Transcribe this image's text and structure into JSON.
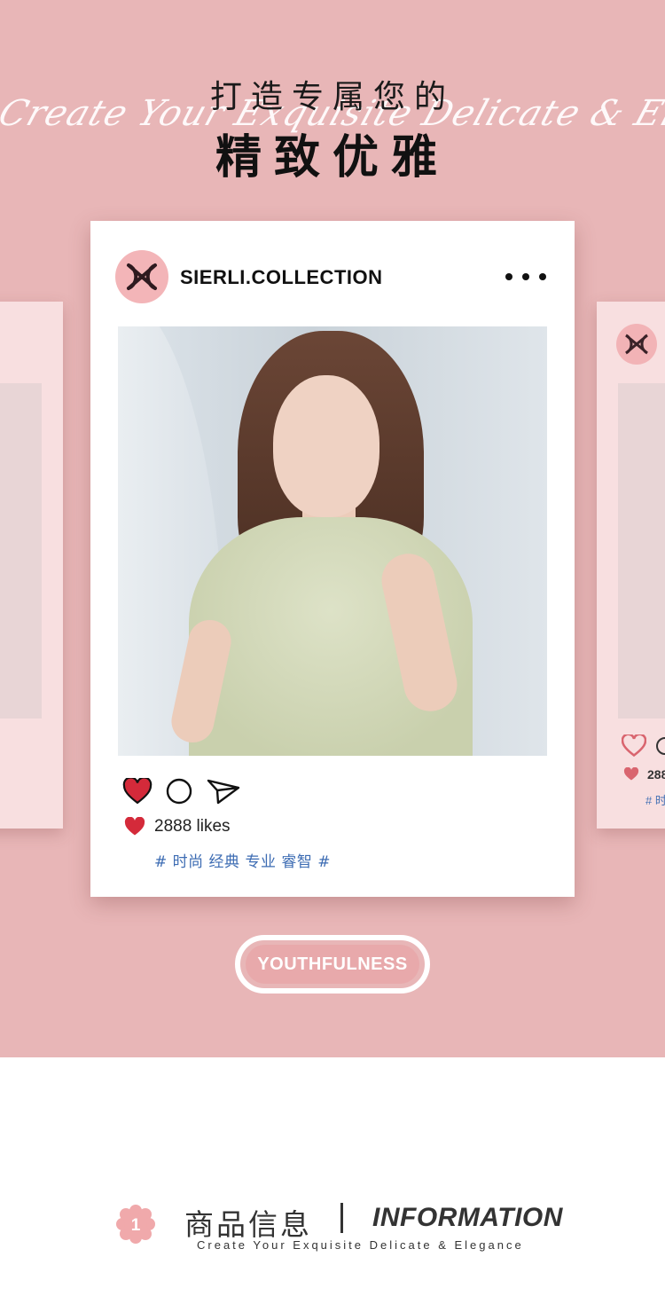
{
  "header": {
    "title_line1": "打造专属您的",
    "title_line2": "精致优雅",
    "script_text": "Create Your Exquisite Delicate & Elegance"
  },
  "post": {
    "logo_icon": "sierli-logo-icon",
    "handle": "SIERLI.COLLECTION",
    "more_icon": "more-options-icon",
    "photo_icon": "model-photo",
    "actions": [
      "heart-icon",
      "comment-icon",
      "send-icon"
    ],
    "likes_count_text": "2888 likes",
    "hashtags": "# 时尚 经典 专业 睿智 #"
  },
  "side_cards": {
    "right_likes_text": "288",
    "right_tag_text": "# 时"
  },
  "badge": {
    "label": "YOUTHFULNESS"
  },
  "section": {
    "number": "1",
    "title_cn": "商品信息",
    "title_en": "INFORMATION",
    "subtitle": "Create Your Exquisite Delicate & Elegance"
  },
  "colors": {
    "background_pink": "#e8b6b7",
    "card_white": "#ffffff",
    "logo_pink": "#f3b5b8",
    "heart_red": "#d42a3a",
    "hashtag_blue": "#3d6cb3",
    "badge_pink": "#e8a9ab",
    "flower_pink": "#f0a9ab"
  }
}
